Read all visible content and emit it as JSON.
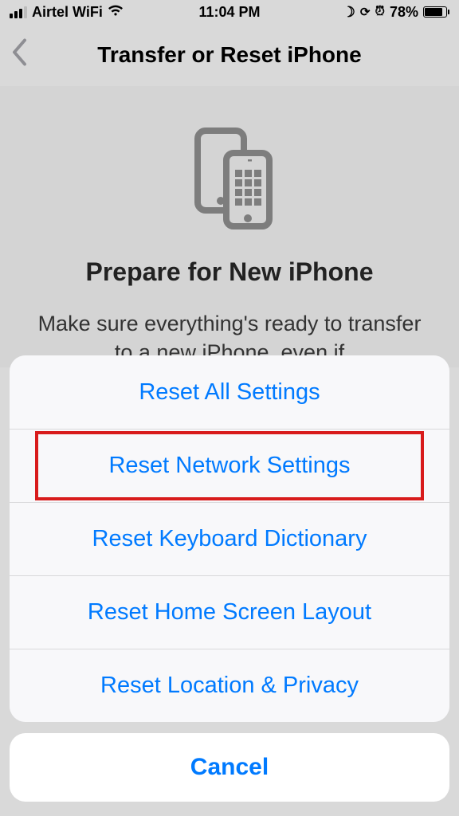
{
  "status": {
    "carrier": "Airtel WiFi",
    "time": "11:04 PM",
    "battery_pct": "78%"
  },
  "nav": {
    "title": "Transfer or Reset iPhone"
  },
  "prepare": {
    "title": "Prepare for New iPhone",
    "body": "Make sure everything's ready to transfer to a new iPhone, even if"
  },
  "sheet": {
    "items": [
      "Reset All Settings",
      "Reset Network Settings",
      "Reset Keyboard Dictionary",
      "Reset Home Screen Layout",
      "Reset Location & Privacy"
    ],
    "cancel": "Cancel"
  }
}
